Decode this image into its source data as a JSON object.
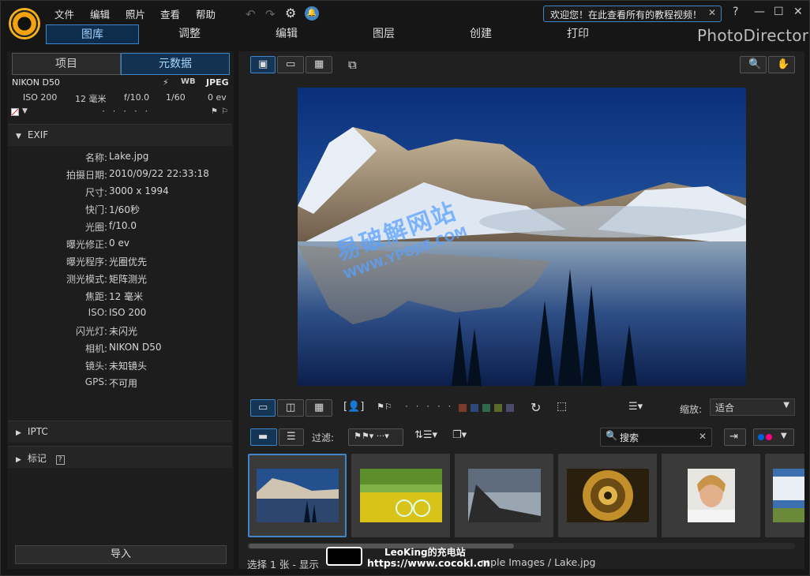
{
  "menu": {
    "file": "文件",
    "edit": "编辑",
    "photo": "照片",
    "view": "查看",
    "help": "帮助"
  },
  "tip": {
    "text": "欢迎您！在此查看所有的教程视频！"
  },
  "modules": [
    "图库",
    "调整",
    "编辑",
    "图层",
    "创建",
    "打印"
  ],
  "brand": "PhotoDirector",
  "panel_tabs": {
    "project": "项目",
    "metadata": "元数据"
  },
  "camera": {
    "model": "NIKON D50",
    "format": "JPEG",
    "iso": "ISO 200",
    "focal": "12 毫米",
    "aperture": "f/10.0",
    "shutter": "1/60",
    "ev": "0 ev"
  },
  "exif": {
    "title": "EXIF",
    "rows": [
      {
        "k": "名称:",
        "v": "Lake.jpg"
      },
      {
        "k": "拍摄日期:",
        "v": "2010/09/22 22:33:18"
      },
      {
        "k": "尺寸:",
        "v": "3000 x 1994"
      },
      {
        "k": "快门:",
        "v": "1/60秒"
      },
      {
        "k": "光圈:",
        "v": "f/10.0"
      },
      {
        "k": "曝光修正:",
        "v": "0 ev"
      },
      {
        "k": "曝光程序:",
        "v": "光圈优先"
      },
      {
        "k": "测光模式:",
        "v": "矩阵测光"
      },
      {
        "k": "焦距:",
        "v": "12 毫米"
      },
      {
        "k": "ISO:",
        "v": "ISO 200"
      },
      {
        "k": "闪光灯:",
        "v": "未闪光"
      },
      {
        "k": "相机:",
        "v": "NIKON D50"
      },
      {
        "k": "镜头:",
        "v": "未知镜头"
      },
      {
        "k": "GPS:",
        "v": "不可用"
      }
    ]
  },
  "sections": {
    "iptc": "IPTC",
    "tags": "标记"
  },
  "import_label": "导入",
  "watermark": {
    "line1": "易破解网站",
    "line2": "WWW.YPOJIE.COM"
  },
  "zoom": {
    "label": "缩放:",
    "value": "适合"
  },
  "filter": {
    "label": "过滤:"
  },
  "search": {
    "placeholder": "搜索"
  },
  "status": {
    "text": "选择 1 张 - 显示",
    "path": "mple Images / Lake.jpg"
  },
  "overlay": {
    "line1": "LeoKing的充电站",
    "line2": "https://www.cocokl.cn"
  },
  "colors": {
    "accent": "#3f86c8",
    "brand_orange": "#f4a30f"
  },
  "label_colors": [
    "#7a3b2a",
    "#2b4a7a",
    "#2f6a4a",
    "#5a6a2a",
    "#4a4a6a"
  ]
}
